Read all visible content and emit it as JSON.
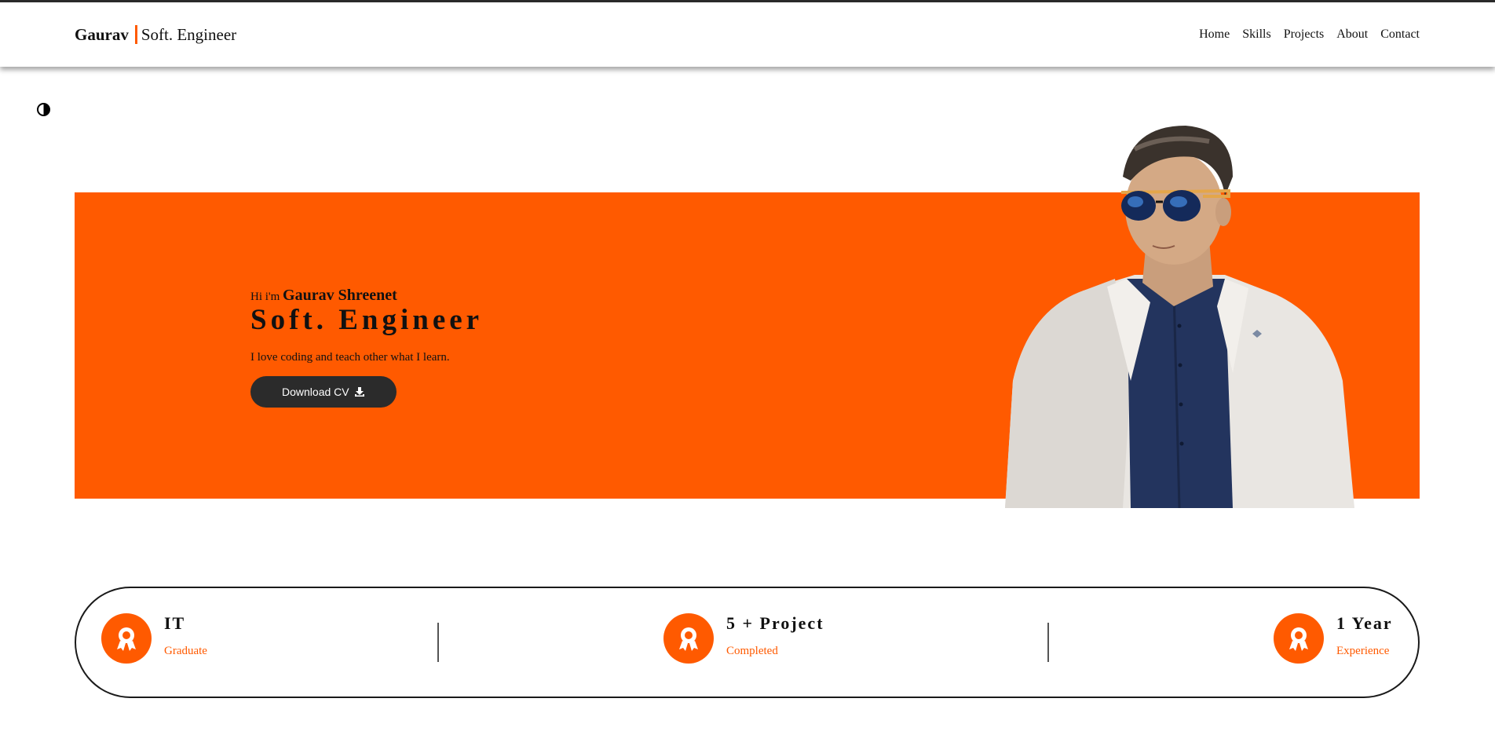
{
  "navbar": {
    "brand_name": "Gaurav",
    "brand_role": "Soft. Engineer",
    "links": [
      {
        "label": "Home"
      },
      {
        "label": "Skills"
      },
      {
        "label": "Projects"
      },
      {
        "label": "About"
      },
      {
        "label": "Contact"
      }
    ]
  },
  "theme_toggle": {
    "icon": "contrast-icon"
  },
  "hero": {
    "greeting_prefix": "Hi i'm",
    "name": "Gaurav Shreenet",
    "title": "Soft. Engineer",
    "tagline": "I love coding and teach other what I learn.",
    "cv_button_label": "Download CV",
    "cv_button_icon": "download-icon",
    "portrait": "portrait-photo"
  },
  "stats": [
    {
      "title": "IT",
      "subtitle": "Graduate",
      "icon": "award-icon"
    },
    {
      "title": "5 + Project",
      "subtitle": "Completed",
      "icon": "award-icon"
    },
    {
      "title": "1 Year",
      "subtitle": "Experience",
      "icon": "award-icon"
    }
  ],
  "colors": {
    "accent": "#ff5a00",
    "dark": "#2b2b2b",
    "background": "#ffffff"
  }
}
